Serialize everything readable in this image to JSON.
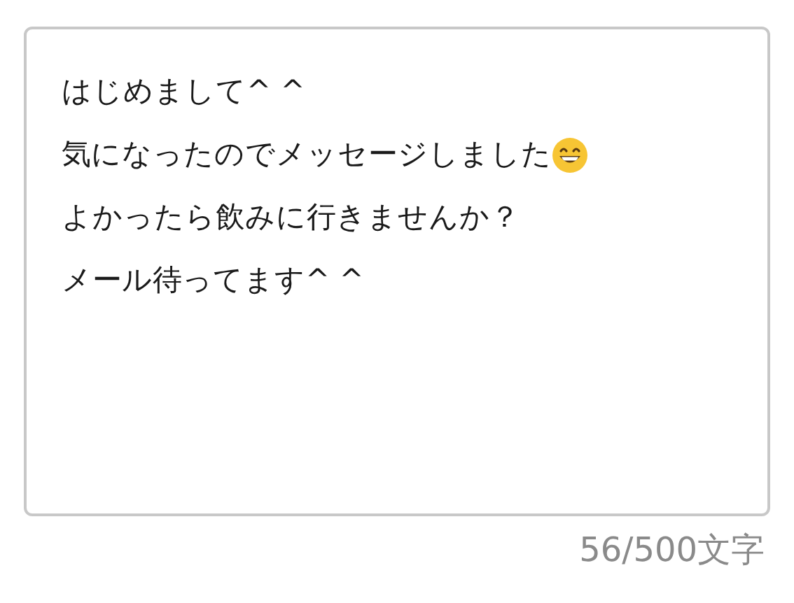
{
  "message": {
    "lines": [
      {
        "text": "はじめまして^ ^",
        "emoji": false
      },
      {
        "text": "気になったのでメッセージしました",
        "emoji": true
      },
      {
        "text": "よかったら飲みに行きませんか？",
        "emoji": false
      },
      {
        "text": "メール待ってます^ ^",
        "emoji": false
      }
    ]
  },
  "counter": "56/500文字"
}
